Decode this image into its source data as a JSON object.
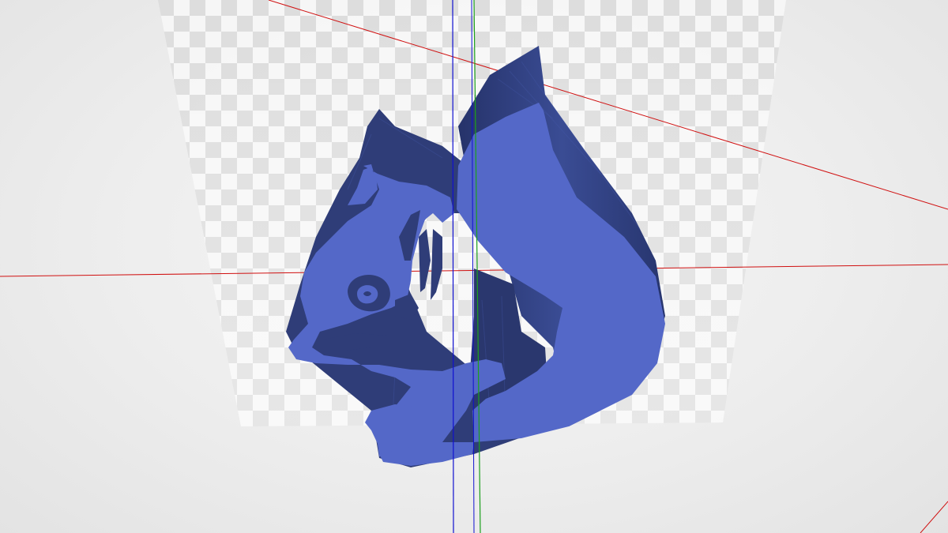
{
  "viewer": {
    "background_color": "#ececec",
    "build_plate": {
      "checker_light": "#f7f7f7",
      "checker_dark": "#d4d4d4"
    },
    "axes": {
      "x_color": "#d01010",
      "y_color": "#1ca01c",
      "z_color": "#1010d0"
    },
    "model": {
      "shape": "squirrel",
      "face_color": "#5468c8",
      "side_color": "#2f3d78",
      "side_highlight": "#3d4f98"
    }
  }
}
